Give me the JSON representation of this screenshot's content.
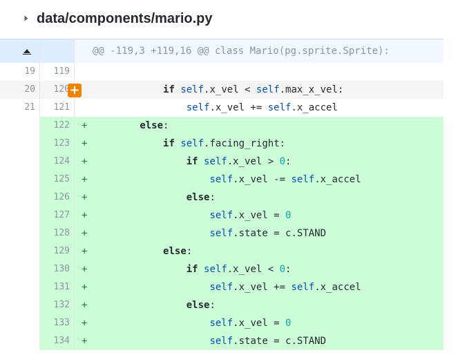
{
  "file": {
    "path": "data/components/mario.py"
  },
  "hunk": {
    "header": "@@ -119,3 +119,16 @@ class Mario(pg.sprite.Sprite):"
  },
  "add_comment_symbol": "+",
  "lines": [
    {
      "type": "ctx",
      "old": "19",
      "new": "119",
      "marker": "",
      "tokens": []
    },
    {
      "type": "ctx-hl",
      "old": "20",
      "new": "120",
      "marker": "",
      "tokens": [
        {
          "t": "            "
        },
        {
          "t": "if",
          "c": "kw"
        },
        {
          "t": " "
        },
        {
          "t": "self",
          "c": "self"
        },
        {
          "t": ".x_vel < "
        },
        {
          "t": "self",
          "c": "self"
        },
        {
          "t": ".max_x_vel:"
        }
      ]
    },
    {
      "type": "ctx",
      "old": "21",
      "new": "121",
      "marker": "",
      "tokens": [
        {
          "t": "                "
        },
        {
          "t": "self",
          "c": "self"
        },
        {
          "t": ".x_vel += "
        },
        {
          "t": "self",
          "c": "self"
        },
        {
          "t": ".x_accel"
        }
      ]
    },
    {
      "type": "add",
      "old": "",
      "new": "122",
      "marker": "+",
      "tokens": [
        {
          "t": "        "
        },
        {
          "t": "else",
          "c": "kw"
        },
        {
          "t": ":"
        }
      ]
    },
    {
      "type": "add",
      "old": "",
      "new": "123",
      "marker": "+",
      "tokens": [
        {
          "t": "            "
        },
        {
          "t": "if",
          "c": "kw"
        },
        {
          "t": " "
        },
        {
          "t": "self",
          "c": "self"
        },
        {
          "t": ".facing_right:"
        }
      ]
    },
    {
      "type": "add",
      "old": "",
      "new": "124",
      "marker": "+",
      "tokens": [
        {
          "t": "                "
        },
        {
          "t": "if",
          "c": "kw"
        },
        {
          "t": " "
        },
        {
          "t": "self",
          "c": "self"
        },
        {
          "t": ".x_vel > "
        },
        {
          "t": "0",
          "c": "num"
        },
        {
          "t": ":"
        }
      ]
    },
    {
      "type": "add",
      "old": "",
      "new": "125",
      "marker": "+",
      "tokens": [
        {
          "t": "                    "
        },
        {
          "t": "self",
          "c": "self"
        },
        {
          "t": ".x_vel -= "
        },
        {
          "t": "self",
          "c": "self"
        },
        {
          "t": ".x_accel"
        }
      ]
    },
    {
      "type": "add",
      "old": "",
      "new": "126",
      "marker": "+",
      "tokens": [
        {
          "t": "                "
        },
        {
          "t": "else",
          "c": "kw"
        },
        {
          "t": ":"
        }
      ]
    },
    {
      "type": "add",
      "old": "",
      "new": "127",
      "marker": "+",
      "tokens": [
        {
          "t": "                    "
        },
        {
          "t": "self",
          "c": "self"
        },
        {
          "t": ".x_vel = "
        },
        {
          "t": "0",
          "c": "num"
        }
      ]
    },
    {
      "type": "add",
      "old": "",
      "new": "128",
      "marker": "+",
      "tokens": [
        {
          "t": "                    "
        },
        {
          "t": "self",
          "c": "self"
        },
        {
          "t": ".state = c.STAND"
        }
      ]
    },
    {
      "type": "add",
      "old": "",
      "new": "129",
      "marker": "+",
      "tokens": [
        {
          "t": "            "
        },
        {
          "t": "else",
          "c": "kw"
        },
        {
          "t": ":"
        }
      ]
    },
    {
      "type": "add",
      "old": "",
      "new": "130",
      "marker": "+",
      "tokens": [
        {
          "t": "                "
        },
        {
          "t": "if",
          "c": "kw"
        },
        {
          "t": " "
        },
        {
          "t": "self",
          "c": "self"
        },
        {
          "t": ".x_vel < "
        },
        {
          "t": "0",
          "c": "num"
        },
        {
          "t": ":"
        }
      ]
    },
    {
      "type": "add",
      "old": "",
      "new": "131",
      "marker": "+",
      "tokens": [
        {
          "t": "                    "
        },
        {
          "t": "self",
          "c": "self"
        },
        {
          "t": ".x_vel += "
        },
        {
          "t": "self",
          "c": "self"
        },
        {
          "t": ".x_accel"
        }
      ]
    },
    {
      "type": "add",
      "old": "",
      "new": "132",
      "marker": "+",
      "tokens": [
        {
          "t": "                "
        },
        {
          "t": "else",
          "c": "kw"
        },
        {
          "t": ":"
        }
      ]
    },
    {
      "type": "add",
      "old": "",
      "new": "133",
      "marker": "+",
      "tokens": [
        {
          "t": "                    "
        },
        {
          "t": "self",
          "c": "self"
        },
        {
          "t": ".x_vel = "
        },
        {
          "t": "0",
          "c": "num"
        }
      ]
    },
    {
      "type": "add",
      "old": "",
      "new": "134",
      "marker": "+",
      "tokens": [
        {
          "t": "                    "
        },
        {
          "t": "self",
          "c": "self"
        },
        {
          "t": ".state = c.STAND"
        }
      ]
    }
  ],
  "colors": {
    "added_line_bg": "#ccffd8",
    "hunk_bg": "#f1f8ff",
    "comment_button": "#f08200",
    "self_token": "#0550ae",
    "number_token": "#0aa5a5"
  }
}
